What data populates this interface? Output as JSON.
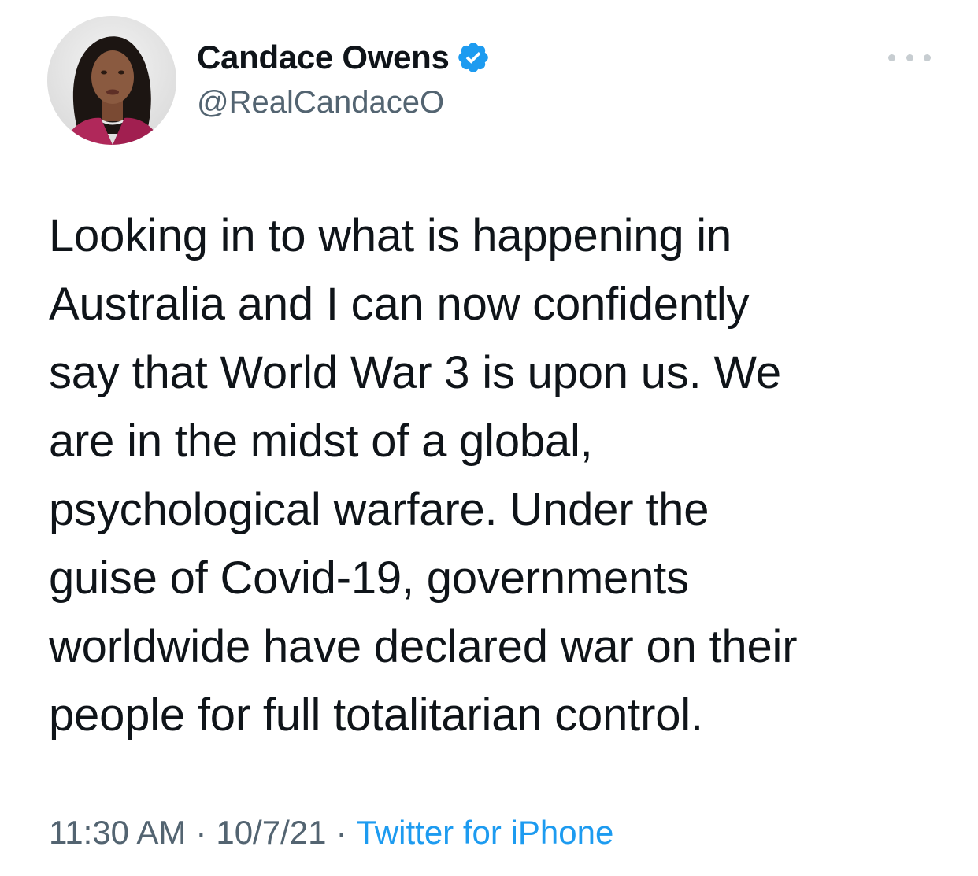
{
  "tweet": {
    "author": {
      "display_name": "Candace Owens",
      "handle": "@RealCandaceO",
      "verified": true,
      "avatar_icon": "profile-photo"
    },
    "more_icon": "more-options-icon",
    "text": "Looking in to what is happening in\nAustralia and I can now confidently\nsay that World War 3 is upon us. We\nare in the midst of a global,\npsychological warfare. Under the\nguise of Covid-19, governments\nworldwide have declared war on their\npeople for full totalitarian control.",
    "meta": {
      "time": "11:30 AM",
      "separator": "·",
      "date": "10/7/21",
      "source": "Twitter for iPhone"
    }
  },
  "colors": {
    "text_primary": "#0f1419",
    "text_secondary": "#536471",
    "link": "#1d9bf0",
    "verified_badge": "#1d9bf0",
    "more_dots": "#c7cdd1"
  }
}
